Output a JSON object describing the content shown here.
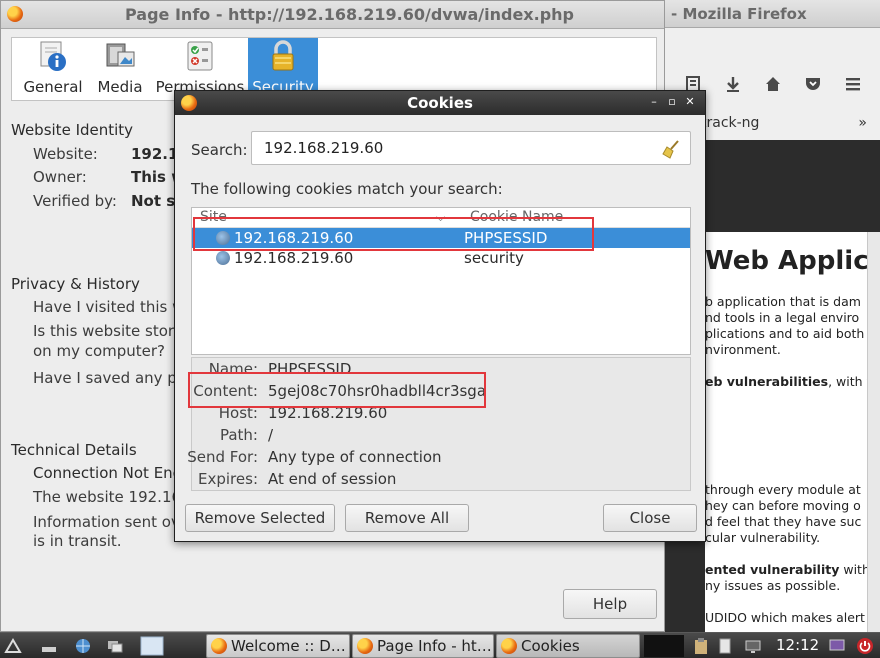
{
  "firefox": {
    "title": "- Mozilla Firefox",
    "bookmark_item": "track-ng",
    "bookmark_overflow": "»",
    "page_heading": "Web Applica",
    "page_lines": [
      "b application that is dam",
      "nd tools in a legal enviro",
      "plications and to aid both",
      "nvironment."
    ],
    "vuln_line_bold": "eb vulnerabilities",
    "vuln_line_rest": ", with v",
    "module_lines": [
      "through every module at",
      "hey can before moving o",
      "d feel that they have suc",
      "cular vulnerability."
    ],
    "content_line_bold": "ented vulnerability",
    "content_line_rest": " with this so",
    "issues_line": "ny issues as possible.",
    "last_line": "UDIDO which makes alert"
  },
  "page_info": {
    "title": "Page Info - http://192.168.219.60/dvwa/index.php",
    "tabs": [
      {
        "label": "General"
      },
      {
        "label": "Media"
      },
      {
        "label": "Permissions"
      },
      {
        "label": "Security"
      }
    ],
    "identity": {
      "heading": "Website Identity",
      "website_label": "Website:",
      "website_value": "192.16",
      "owner_label": "Owner:",
      "owner_value": "This w",
      "verified_label": "Verified by:",
      "verified_value": "Not sp"
    },
    "privacy": {
      "heading": "Privacy & History",
      "q1": "Have I visited this web",
      "q2a": "Is this website storing",
      "q2b": "on my computer?",
      "q3": "Have I saved any pass"
    },
    "technical": {
      "heading": "Technical Details",
      "subheading": "Connection Not Encr",
      "line1": "The website 192.168",
      "line2a": "Information sent over",
      "line2b": "is in transit."
    },
    "help_label": "Help"
  },
  "cookies": {
    "title": "Cookies",
    "search_label": "Search:",
    "search_value": "192.168.219.60",
    "match_text": "The following cookies match your search:",
    "col_site": "Site",
    "col_name": "Cookie Name",
    "rows": [
      {
        "site": "192.168.219.60",
        "name": "PHPSESSID"
      },
      {
        "site": "192.168.219.60",
        "name": "security"
      }
    ],
    "details": {
      "name_label": "Name:",
      "name_value": "PHPSESSID",
      "content_label": "Content:",
      "content_value": "5gej08c70hsr0hadbll4cr3sga",
      "host_label": "Host:",
      "host_value": "192.168.219.60",
      "path_label": "Path:",
      "path_value": "/",
      "sendfor_label": "Send For:",
      "sendfor_value": "Any type of connection",
      "expires_label": "Expires:",
      "expires_value": "At end of session"
    },
    "remove_selected": "Remove Selected",
    "remove_all": "Remove All",
    "close": "Close"
  },
  "taskbar": {
    "tasks": [
      {
        "label": "Welcome :: D…"
      },
      {
        "label": "Page Info - ht…"
      },
      {
        "label": "Cookies"
      }
    ],
    "clock": "12:12"
  }
}
